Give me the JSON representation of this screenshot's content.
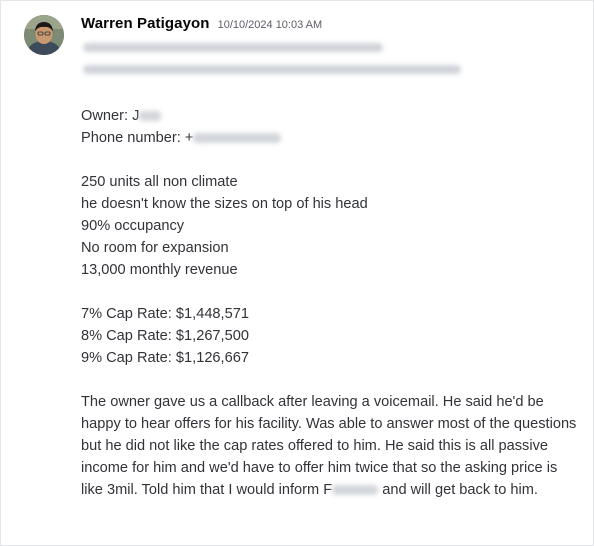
{
  "message": {
    "author": "Warren Patigayon",
    "timestamp": "10/10/2024 10:03 AM",
    "owner_label": "Owner:",
    "owner_value": "J",
    "phone_label": "Phone number:",
    "phone_value": "+",
    "facility_lines": [
      "250 units all non climate",
      "he doesn't know the sizes on top of his head",
      "90% occupancy",
      "No room for expansion",
      "13,000 monthly revenue"
    ],
    "cap_rates": [
      "7% Cap Rate: $1,448,571",
      "8% Cap Rate: $1,267,500",
      "9% Cap Rate: $1,126,667"
    ],
    "notes_before_redaction": "The owner gave us a callback after leaving a voicemail. He said he'd be happy to hear offers for his facility. Was able to answer most of the questions but he did not like the cap rates offered to him. He said this is all passive income for him and we'd have to offer him twice that so the asking price is like 3mil. Told him that I would inform F",
    "notes_after_redaction": "and will get back to him."
  },
  "colors": {
    "author": "#060607",
    "timestamp": "#5c5e66",
    "body_text": "#313338",
    "redaction_blur": "#cfd3d8"
  }
}
